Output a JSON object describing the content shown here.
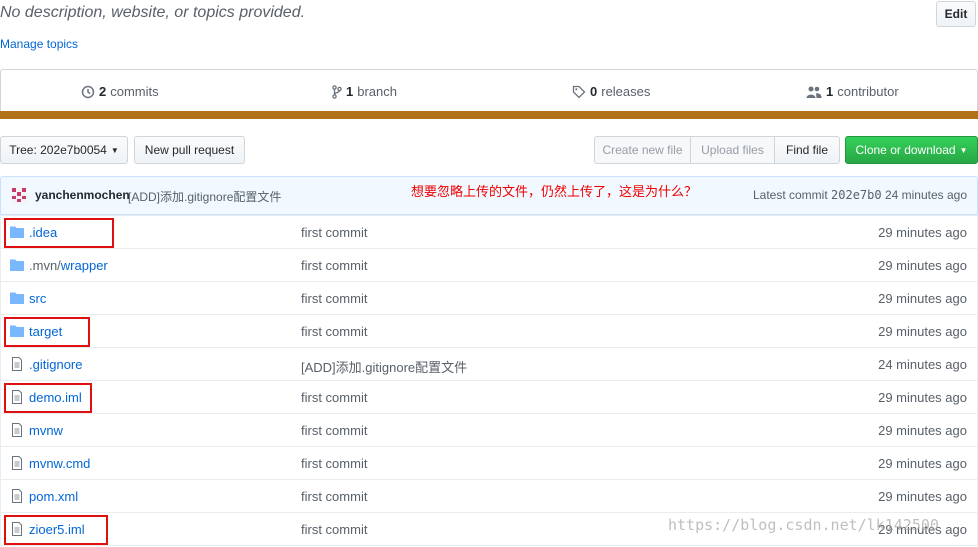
{
  "repo": {
    "description": "No description, website, or topics provided.",
    "edit_label": "Edit",
    "manage_topics": "Manage topics"
  },
  "summary": {
    "commits_count": "2",
    "commits_label": "commits",
    "branches_count": "1",
    "branches_label": "branch",
    "releases_count": "0",
    "releases_label": "releases",
    "contributors_count": "1",
    "contributors_label": "contributor",
    "language_color": "#b07219"
  },
  "toolbar": {
    "tree_label": "Tree: 202e7b0054",
    "new_pull_request": "New pull request",
    "create_new_file": "Create new file",
    "upload_files": "Upload files",
    "find_file": "Find file",
    "clone_or_download": "Clone or download"
  },
  "latest_commit": {
    "author": "yanchenmochen",
    "message": "[ADD]添加.gitignore配置文件",
    "annotation": "想要忽略上传的文件，仍然上传了，这是为什么？",
    "latest_label": "Latest commit",
    "sha": "202e7b0",
    "time": "24 minutes ago"
  },
  "files": [
    {
      "name": ".idea",
      "type": "folder",
      "message": "first commit",
      "age": "29 minutes ago",
      "highlighted": true
    },
    {
      "name_dim": ".mvn/",
      "name": "wrapper",
      "type": "folder",
      "message": "first commit",
      "age": "29 minutes ago",
      "highlighted": false
    },
    {
      "name": "src",
      "type": "folder",
      "message": "first commit",
      "age": "29 minutes ago",
      "highlighted": false
    },
    {
      "name": "target",
      "type": "folder",
      "message": "first commit",
      "age": "29 minutes ago",
      "highlighted": true
    },
    {
      "name": ".gitignore",
      "type": "file",
      "message": "[ADD]添加.gitignore配置文件",
      "age": "24 minutes ago",
      "highlighted": false
    },
    {
      "name": "demo.iml",
      "type": "file",
      "message": "first commit",
      "age": "29 minutes ago",
      "highlighted": true
    },
    {
      "name": "mvnw",
      "type": "file",
      "message": "first commit",
      "age": "29 minutes ago",
      "highlighted": false
    },
    {
      "name": "mvnw.cmd",
      "type": "file",
      "message": "first commit",
      "age": "29 minutes ago",
      "highlighted": false
    },
    {
      "name": "pom.xml",
      "type": "file",
      "message": "first commit",
      "age": "29 minutes ago",
      "highlighted": false
    },
    {
      "name": "zioer5.iml",
      "type": "file",
      "message": "first commit",
      "age": "29 minutes ago",
      "highlighted": true
    }
  ],
  "watermark": "https://blog.csdn.net/lk142500"
}
